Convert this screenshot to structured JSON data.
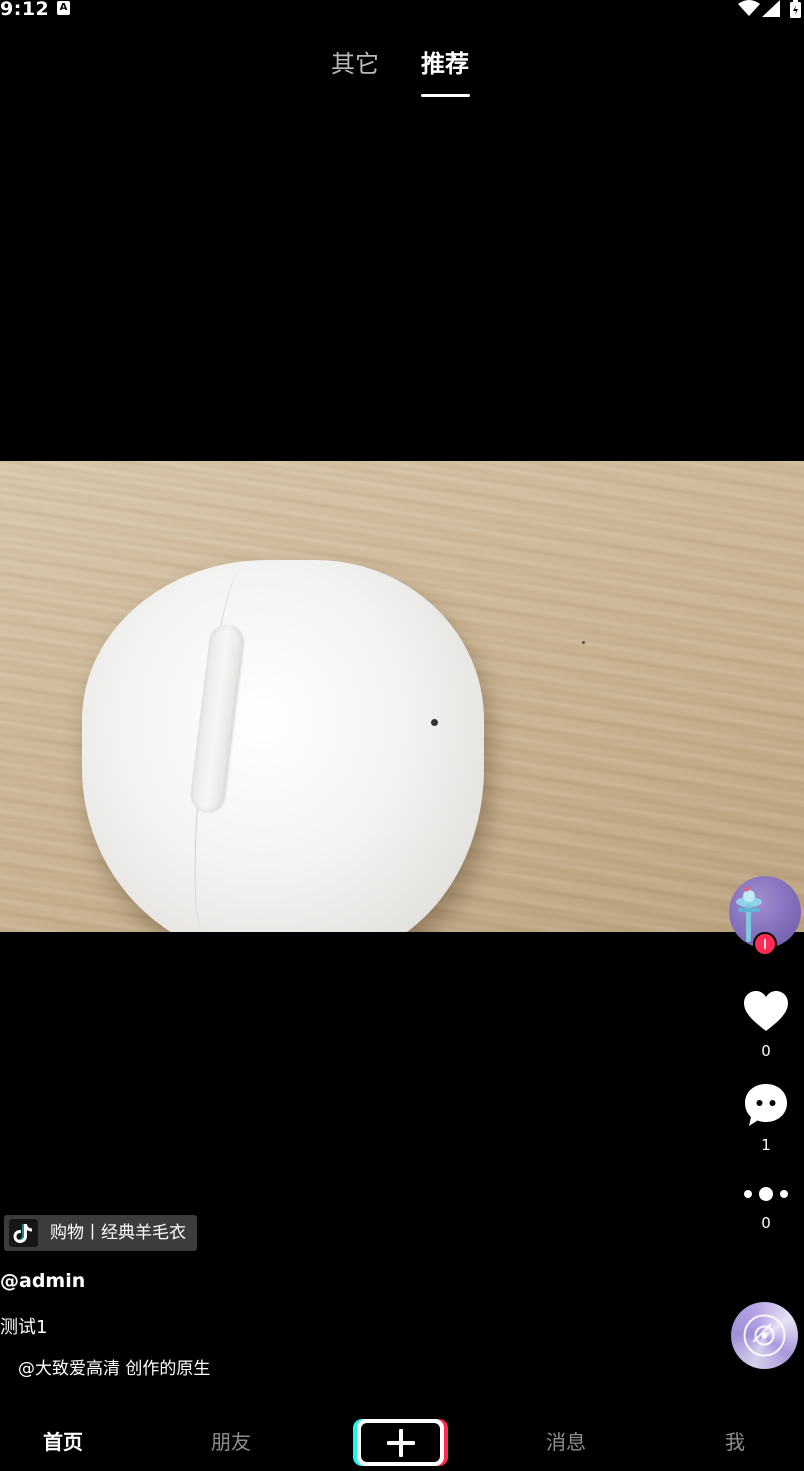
{
  "status_bar": {
    "time": "9:12",
    "notification_icon": "a-icon"
  },
  "top_tabs": {
    "other": "其它",
    "recommend": "推荐",
    "active": "recommend"
  },
  "actions": {
    "likes": "0",
    "comments": "1",
    "shares": "0"
  },
  "shop_tag": {
    "label": "购物丨经典羊毛衣"
  },
  "post": {
    "username": "@admin",
    "description": "测试1",
    "music": "@大致爱高清 创作的原生"
  },
  "bottom_nav": {
    "home": "首页",
    "friends": "朋友",
    "messages": "消息",
    "me": "我"
  },
  "colors": {
    "background": "#000000",
    "like_red": "#fe2c55",
    "accent_cyan": "#25f4ee"
  }
}
